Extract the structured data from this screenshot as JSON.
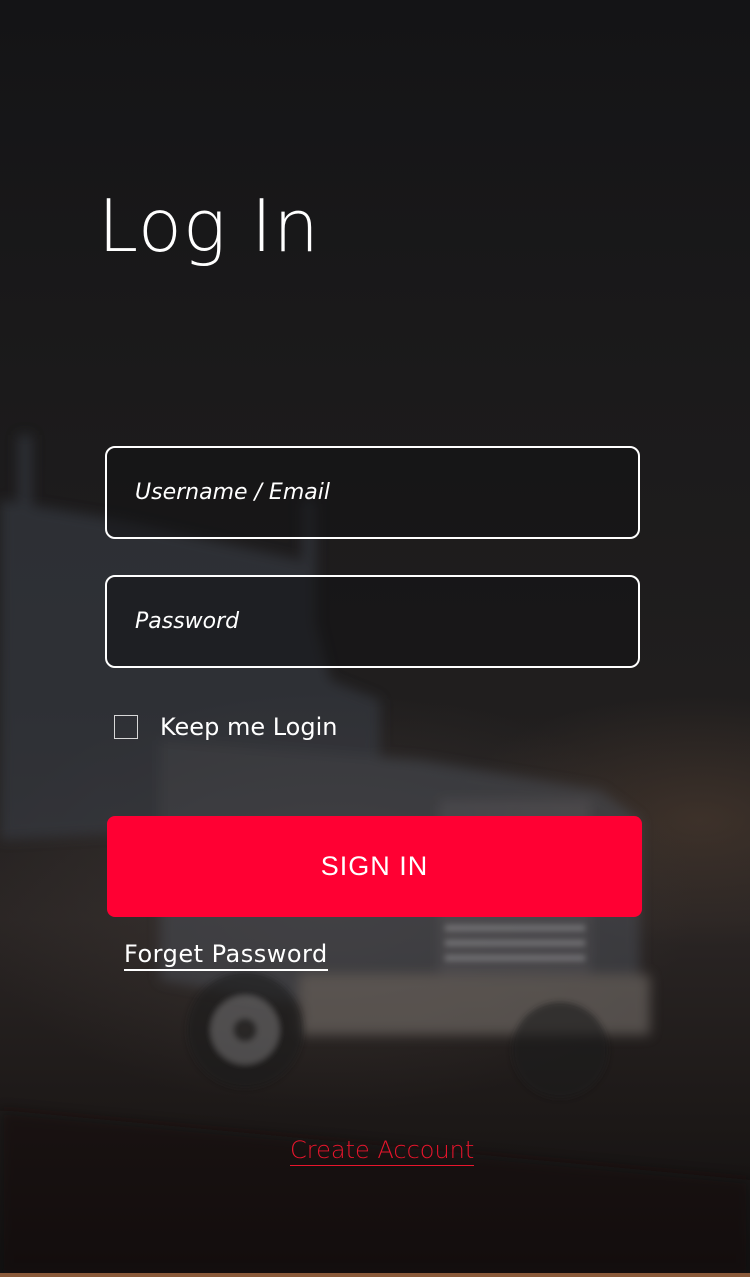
{
  "page": {
    "title": "Log In"
  },
  "form": {
    "username_placeholder": "Username / Email",
    "username_value": "",
    "password_placeholder": "Password",
    "password_value": "",
    "keep_login_label": "Keep me Login",
    "keep_login_checked": false,
    "signin_label": "SIGN IN",
    "forgot_label": "Forget Password",
    "create_account_label": "Create Account"
  },
  "colors": {
    "accent": "#ff0033",
    "link_accent": "#e8152c",
    "background": "#1b1a1b",
    "text": "#ffffff"
  },
  "icons": {
    "checkbox": "checkbox-unchecked-icon"
  }
}
